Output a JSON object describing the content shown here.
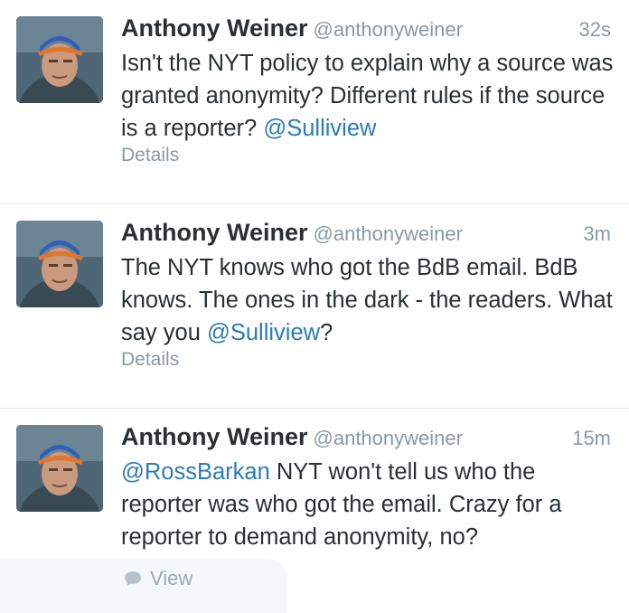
{
  "tweets": [
    {
      "fullname": "Anthony Weiner",
      "username": "@anthonyweiner",
      "time": "32s",
      "text_parts": [
        "Isn't the NYT policy to explain why a source was granted anonymity?  Different rules if the source is a reporter?  ",
        "@Sulliview",
        ""
      ],
      "details": "Details"
    },
    {
      "fullname": "Anthony Weiner",
      "username": "@anthonyweiner",
      "time": "3m",
      "text_parts": [
        "The NYT knows who got the BdB email. BdB knows. The ones in the dark - the readers.  What say you ",
        "@Sulliview",
        "?"
      ],
      "details": "Details"
    },
    {
      "fullname": "Anthony Weiner",
      "username": "@anthonyweiner",
      "time": "15m",
      "text_parts": [
        "",
        "@RossBarkan",
        " NYT won't tell us who the reporter was who got the email.  Crazy for a reporter to demand anonymity, no?"
      ]
    }
  ],
  "footer": {
    "view_label": "View",
    "icon": "speech-bubble-icon"
  },
  "colors": {
    "link": "#2b7bb9",
    "meta": "#8899a6",
    "text": "#292f33"
  }
}
